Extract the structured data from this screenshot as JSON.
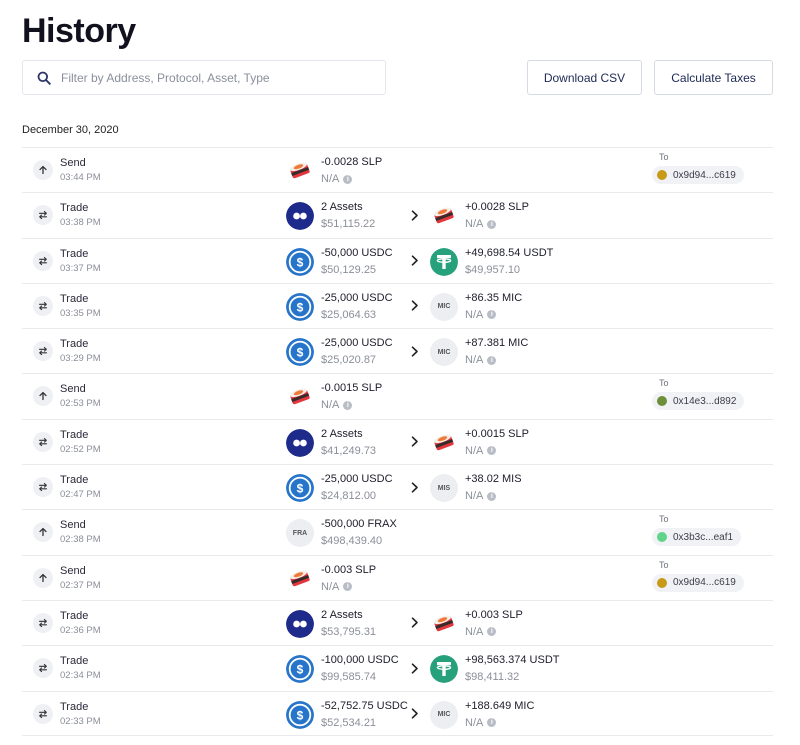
{
  "page": {
    "title": "History",
    "search_placeholder": "Filter by Address, Protocol, Asset, Type",
    "download_label": "Download CSV",
    "taxes_label": "Calculate Taxes",
    "date": "December 30, 2020"
  },
  "to_label": "To",
  "rows": [
    {
      "type": "Send",
      "icon": "arrow-up-icon",
      "time": "03:44 PM",
      "in": {
        "token": "slp",
        "amount": "-0.0028 SLP",
        "value": "N/A",
        "info": true
      },
      "to": "0x9d94...c619",
      "addr_color": "#c89a1a"
    },
    {
      "type": "Trade",
      "icon": "swap-icon",
      "time": "03:38 PM",
      "in": {
        "token": "multi",
        "amount": "2 Assets",
        "value": "$51,115.22"
      },
      "out": {
        "token": "slp",
        "amount": "+0.0028 SLP",
        "value": "N/A",
        "info": true
      }
    },
    {
      "type": "Trade",
      "icon": "swap-icon",
      "time": "03:37 PM",
      "in": {
        "token": "usdc",
        "amount": "-50,000 USDC",
        "value": "$50,129.25"
      },
      "out": {
        "token": "usdt",
        "amount": "+49,698.54 USDT",
        "value": "$49,957.10"
      }
    },
    {
      "type": "Trade",
      "icon": "swap-icon",
      "time": "03:35 PM",
      "in": {
        "token": "usdc",
        "amount": "-25,000 USDC",
        "value": "$25,064.63"
      },
      "out": {
        "token": "gray",
        "token_label": "MIC",
        "amount": "+86.35 MIC",
        "value": "N/A",
        "info": true
      }
    },
    {
      "type": "Trade",
      "icon": "swap-icon",
      "time": "03:29 PM",
      "in": {
        "token": "usdc",
        "amount": "-25,000 USDC",
        "value": "$25,020.87"
      },
      "out": {
        "token": "gray",
        "token_label": "MIC",
        "amount": "+87.381 MIC",
        "value": "N/A",
        "info": true
      }
    },
    {
      "type": "Send",
      "icon": "arrow-up-icon",
      "time": "02:53 PM",
      "in": {
        "token": "slp",
        "amount": "-0.0015 SLP",
        "value": "N/A",
        "info": true
      },
      "to": "0x14e3...d892",
      "addr_color": "#6b8f3a"
    },
    {
      "type": "Trade",
      "icon": "swap-icon",
      "time": "02:52 PM",
      "in": {
        "token": "multi",
        "amount": "2 Assets",
        "value": "$41,249.73"
      },
      "out": {
        "token": "slp",
        "amount": "+0.0015 SLP",
        "value": "N/A",
        "info": true
      }
    },
    {
      "type": "Trade",
      "icon": "swap-icon",
      "time": "02:47 PM",
      "in": {
        "token": "usdc",
        "amount": "-25,000 USDC",
        "value": "$24,812.00"
      },
      "out": {
        "token": "gray",
        "token_label": "MIS",
        "amount": "+38.02 MIS",
        "value": "N/A",
        "info": true
      }
    },
    {
      "type": "Send",
      "icon": "arrow-up-icon",
      "time": "02:38 PM",
      "in": {
        "token": "gray",
        "token_label": "FRA",
        "amount": "-500,000 FRAX",
        "value": "$498,439.40"
      },
      "to": "0x3b3c...eaf1",
      "addr_color": "#5fd48a"
    },
    {
      "type": "Send",
      "icon": "arrow-up-icon",
      "time": "02:37 PM",
      "in": {
        "token": "slp",
        "amount": "-0.003 SLP",
        "value": "N/A",
        "info": true
      },
      "to": "0x9d94...c619",
      "addr_color": "#c89a1a"
    },
    {
      "type": "Trade",
      "icon": "swap-icon",
      "time": "02:36 PM",
      "in": {
        "token": "multi",
        "amount": "2 Assets",
        "value": "$53,795.31"
      },
      "out": {
        "token": "slp",
        "amount": "+0.003 SLP",
        "value": "N/A",
        "info": true
      }
    },
    {
      "type": "Trade",
      "icon": "swap-icon",
      "time": "02:34 PM",
      "in": {
        "token": "usdc",
        "amount": "-100,000 USDC",
        "value": "$99,585.74"
      },
      "out": {
        "token": "usdt",
        "amount": "+98,563.374 USDT",
        "value": "$98,411.32"
      }
    },
    {
      "type": "Trade",
      "icon": "swap-icon",
      "time": "02:33 PM",
      "in": {
        "token": "usdc",
        "amount": "-52,752.75 USDC",
        "value": "$52,534.21"
      },
      "out": {
        "token": "gray",
        "token_label": "MIC",
        "amount": "+188.649 MIC",
        "value": "N/A",
        "info": true
      }
    }
  ]
}
